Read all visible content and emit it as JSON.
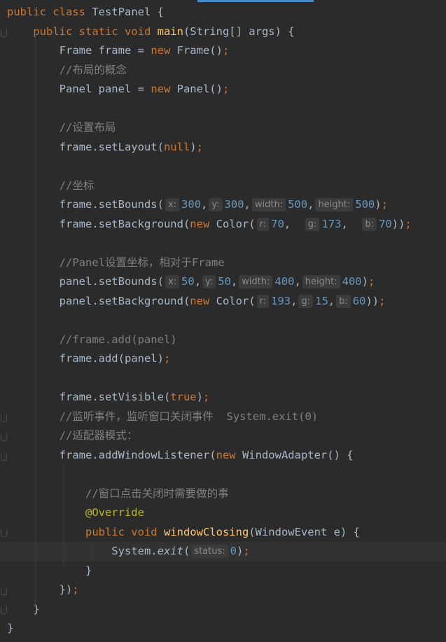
{
  "editor": {
    "language": "Java",
    "lines": [
      [
        {
          "t": "public class ",
          "c": "kw"
        },
        {
          "t": "TestPanel {"
        }
      ],
      [
        {
          "t": "    "
        },
        {
          "t": "public static void ",
          "c": "kw"
        },
        {
          "t": "main",
          "c": "fn"
        },
        {
          "t": "(String[] args) {"
        }
      ],
      [
        {
          "t": "        Frame frame = "
        },
        {
          "t": "new ",
          "c": "kw"
        },
        {
          "t": "Frame()"
        },
        {
          "t": ";",
          "c": "kw"
        }
      ],
      [
        {
          "t": "        "
        },
        {
          "t": "//布局的概念",
          "c": "cm"
        }
      ],
      [
        {
          "t": "        Panel panel = "
        },
        {
          "t": "new ",
          "c": "kw"
        },
        {
          "t": "Panel()"
        },
        {
          "t": ";",
          "c": "kw"
        }
      ],
      [],
      [
        {
          "t": "        "
        },
        {
          "t": "//设置布局",
          "c": "cm"
        }
      ],
      [
        {
          "t": "        frame.setLayout("
        },
        {
          "t": "null",
          "c": "kw"
        },
        {
          "t": ")"
        },
        {
          "t": ";",
          "c": "kw"
        }
      ],
      [],
      [
        {
          "t": "        "
        },
        {
          "t": "//坐标",
          "c": "cm"
        }
      ],
      [
        {
          "t": "        frame.setBounds("
        },
        {
          "h": "x:"
        },
        {
          "t": "300",
          "c": "num"
        },
        {
          "t": ","
        },
        {
          "h": "y:"
        },
        {
          "t": "300",
          "c": "num"
        },
        {
          "t": ","
        },
        {
          "h": "width:"
        },
        {
          "t": "500",
          "c": "num"
        },
        {
          "t": ","
        },
        {
          "h": "height:"
        },
        {
          "t": "500",
          "c": "num"
        },
        {
          "t": ")"
        },
        {
          "t": ";",
          "c": "kw"
        }
      ],
      [
        {
          "t": "        frame.setBackground("
        },
        {
          "t": "new ",
          "c": "kw"
        },
        {
          "t": "Color("
        },
        {
          "h": "r:"
        },
        {
          "t": "70",
          "c": "num"
        },
        {
          "t": ",  "
        },
        {
          "h": "g:"
        },
        {
          "t": "173",
          "c": "num"
        },
        {
          "t": ",  "
        },
        {
          "h": "b:"
        },
        {
          "t": "70",
          "c": "num"
        },
        {
          "t": "))"
        },
        {
          "t": ";",
          "c": "kw"
        }
      ],
      [],
      [
        {
          "t": "        "
        },
        {
          "t": "//Panel设置坐标，相对于Frame",
          "c": "cm"
        }
      ],
      [
        {
          "t": "        panel.setBounds("
        },
        {
          "h": "x:"
        },
        {
          "t": "50",
          "c": "num"
        },
        {
          "t": ","
        },
        {
          "h": "y:"
        },
        {
          "t": "50",
          "c": "num"
        },
        {
          "t": ","
        },
        {
          "h": "width:"
        },
        {
          "t": "400",
          "c": "num"
        },
        {
          "t": ","
        },
        {
          "h": "height:"
        },
        {
          "t": "400",
          "c": "num"
        },
        {
          "t": ")"
        },
        {
          "t": ";",
          "c": "kw"
        }
      ],
      [
        {
          "t": "        panel.setBackground("
        },
        {
          "t": "new ",
          "c": "kw"
        },
        {
          "t": "Color("
        },
        {
          "h": "r:"
        },
        {
          "t": "193",
          "c": "num"
        },
        {
          "t": ","
        },
        {
          "h": "g:"
        },
        {
          "t": "15",
          "c": "num"
        },
        {
          "t": ","
        },
        {
          "h": "b:"
        },
        {
          "t": "60",
          "c": "num"
        },
        {
          "t": "))"
        },
        {
          "t": ";",
          "c": "kw"
        }
      ],
      [],
      [
        {
          "t": "        "
        },
        {
          "t": "//frame.add(panel)",
          "c": "cm"
        }
      ],
      [
        {
          "t": "        frame.add(panel)"
        },
        {
          "t": ";",
          "c": "kw"
        }
      ],
      [],
      [
        {
          "t": "        frame.setVisible("
        },
        {
          "t": "true",
          "c": "kw"
        },
        {
          "t": ")"
        },
        {
          "t": ";",
          "c": "kw"
        }
      ],
      [
        {
          "t": "        "
        },
        {
          "t": "//监听事件，监听窗口关闭事件  System.exit(0)",
          "c": "cm"
        }
      ],
      [
        {
          "t": "        "
        },
        {
          "t": "//适配器模式：",
          "c": "cm"
        }
      ],
      [
        {
          "t": "        frame.addWindowListener("
        },
        {
          "t": "new ",
          "c": "kw"
        },
        {
          "t": "WindowAdapter() {"
        }
      ],
      [],
      [
        {
          "t": "            "
        },
        {
          "t": "//窗口点击关闭时需要做的事",
          "c": "cm"
        }
      ],
      [
        {
          "t": "            "
        },
        {
          "t": "@Override",
          "c": "an"
        }
      ],
      [
        {
          "t": "            "
        },
        {
          "t": "public void ",
          "c": "kw"
        },
        {
          "t": "windowClosing",
          "c": "fn"
        },
        {
          "t": "(WindowEvent e) {"
        }
      ],
      [
        {
          "t": "                System."
        },
        {
          "t": "exit",
          "c": "it"
        },
        {
          "t": "("
        },
        {
          "h": "status:"
        },
        {
          "t": "0",
          "c": "num"
        },
        {
          "t": ")"
        },
        {
          "t": ";",
          "c": "kw"
        }
      ],
      [
        {
          "t": "            }"
        }
      ],
      [
        {
          "t": "        })"
        },
        {
          "t": ";",
          "c": "kw"
        }
      ],
      [
        {
          "t": "    }"
        }
      ],
      [
        {
          "t": "}"
        }
      ]
    ]
  }
}
